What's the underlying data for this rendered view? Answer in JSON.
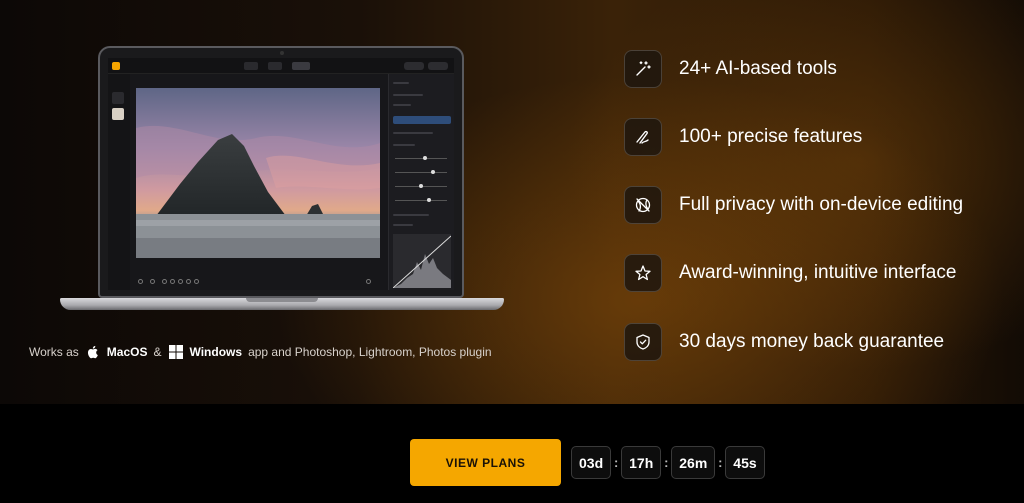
{
  "works_line": {
    "prefix": "Works as",
    "macos": "MacOS",
    "ampersand": "&",
    "windows": "Windows",
    "suffix": "app and Photoshop, Lightroom, Photos plugin"
  },
  "features": [
    {
      "label": "24+ AI-based tools",
      "icon": "magic-wand-icon"
    },
    {
      "label": "100+ precise features",
      "icon": "brush-icon"
    },
    {
      "label": "Full privacy with on-device editing",
      "icon": "privacy-icon"
    },
    {
      "label": "Award-winning, intuitive interface",
      "icon": "star-icon"
    },
    {
      "label": "30 days money back guarantee",
      "icon": "shield-check-icon"
    }
  ],
  "cta": {
    "label": "VIEW PLANS"
  },
  "countdown": {
    "days": "03d",
    "hours": "17h",
    "minutes": "26m",
    "seconds": "45s",
    "separator": ":"
  },
  "colors": {
    "accent": "#f5a700",
    "background": "#000000"
  }
}
